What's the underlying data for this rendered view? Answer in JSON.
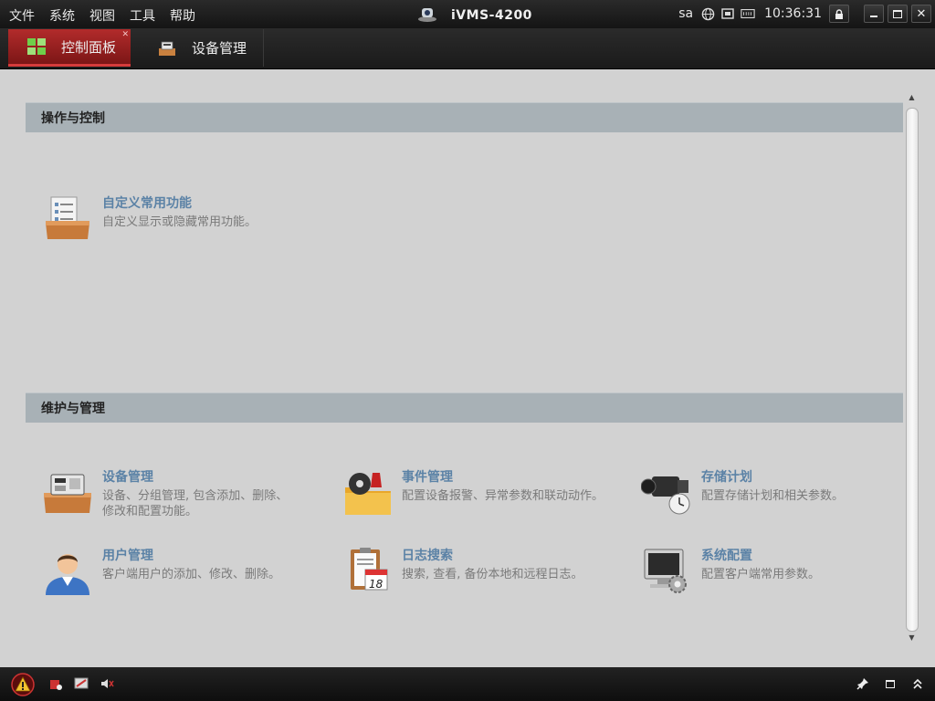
{
  "menubar": {
    "items": [
      "文件",
      "系统",
      "视图",
      "工具",
      "帮助"
    ],
    "app_title": "iVMS-4200",
    "user": "sa",
    "clock": "10:36:31"
  },
  "tabs": [
    {
      "label": "控制面板",
      "active": true
    },
    {
      "label": "设备管理",
      "active": false
    }
  ],
  "sections": [
    {
      "title": "操作与控制",
      "items": [
        {
          "title": "自定义常用功能",
          "desc": "自定义显示或隐藏常用功能。",
          "icon": "custom-functions-icon"
        }
      ]
    },
    {
      "title": "维护与管理",
      "items": [
        {
          "title": "设备管理",
          "desc": "设备、分组管理, 包含添加、删除、修改和配置功能。",
          "icon": "device-management-icon"
        },
        {
          "title": "事件管理",
          "desc": "配置设备报警、异常参数和联动动作。",
          "icon": "event-management-icon"
        },
        {
          "title": "存储计划",
          "desc": "配置存储计划和相关参数。",
          "icon": "storage-schedule-icon"
        },
        {
          "title": "用户管理",
          "desc": "客户端用户的添加、修改、删除。",
          "icon": "user-management-icon"
        },
        {
          "title": "日志搜索",
          "desc": "搜索, 查看, 备份本地和远程日志。",
          "icon": "log-search-icon"
        },
        {
          "title": "系统配置",
          "desc": "配置客户端常用参数。",
          "icon": "system-config-icon"
        }
      ]
    }
  ],
  "colors": {
    "accent": "#b22b2b",
    "item_title": "#5b82a6",
    "section_head": "#a8b1b6"
  },
  "calendar_icon_day": "18"
}
